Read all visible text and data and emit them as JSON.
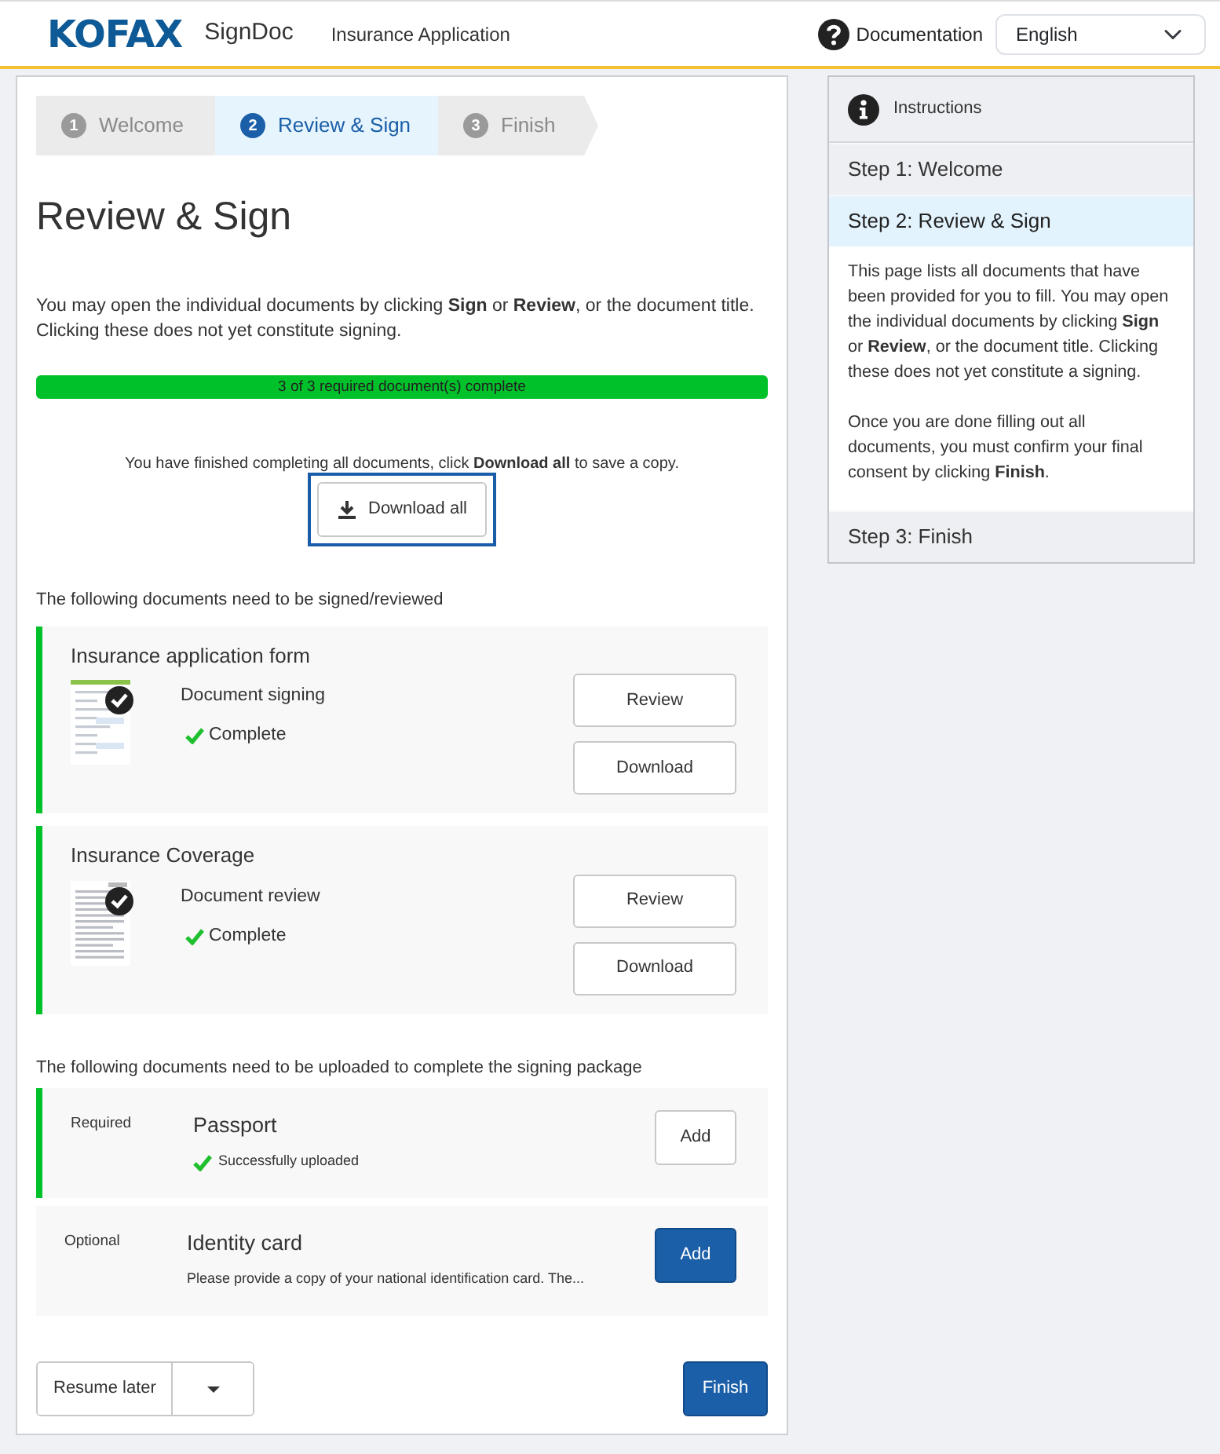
{
  "header": {
    "logo": "KOFAX",
    "app_name": "SignDoc",
    "page_title": "Insurance Application",
    "help_label": "Documentation",
    "language": "English"
  },
  "steps": [
    {
      "number": "1",
      "label": "Welcome",
      "selected": false
    },
    {
      "number": "2",
      "label": "Review & Sign",
      "selected": true
    },
    {
      "number": "3",
      "label": "Finish",
      "selected": false
    }
  ],
  "heading": "Review & Sign",
  "intro": "You may open the individual documents by clicking **Sign** or **Review**, or the document title. Clicking these does not yet constitute signing.",
  "progress": {
    "label": "3 of 3 required document(s) complete",
    "level": 1
  },
  "finished_note": "You have finished completing all documents, click **Download all** to save a copy.",
  "download_all": {
    "label": "Download all",
    "focused": true
  },
  "documents_label": "The following documents need to be signed/reviewed",
  "documents": [
    {
      "title": "Insurance application form",
      "kind": "form",
      "action": "Document signing",
      "status": "Complete",
      "complete": true,
      "buttons": [
        "Review",
        "Download"
      ]
    },
    {
      "title": "Insurance Coverage",
      "kind": "letter",
      "action": "Document review",
      "status": "Complete",
      "complete": true,
      "buttons": [
        "Review",
        "Download"
      ]
    }
  ],
  "uploads_label": "The following documents need to be uploaded to complete the signing package",
  "uploads": [
    {
      "requirement": "Required",
      "title": "Passport",
      "note": "Successfully uploaded",
      "uploaded": true,
      "button": "Add"
    },
    {
      "requirement": "Optional",
      "title": "Identity card",
      "note": "Please provide a copy of your national identification card. The...",
      "uploaded": false,
      "button": "Add"
    }
  ],
  "footer": {
    "resume": "Resume later",
    "finish": "Finish"
  },
  "sidebar": {
    "title": "Instructions",
    "steps": [
      {
        "label": "Step 1: Welcome",
        "selected": false
      },
      {
        "label": "Step 2: Review & Sign",
        "selected": true,
        "paragraphs": [
          "This page lists all documents that have been provided for you to fill. You may open the individual documents by clicking **Sign** or **Review**, or the document title. Clicking these does not yet constitute a signing.",
          "Once you are done filling out all documents, you must confirm your final consent by clicking **Finish**."
        ]
      },
      {
        "label": "Step 3: Finish",
        "selected": false
      }
    ]
  }
}
